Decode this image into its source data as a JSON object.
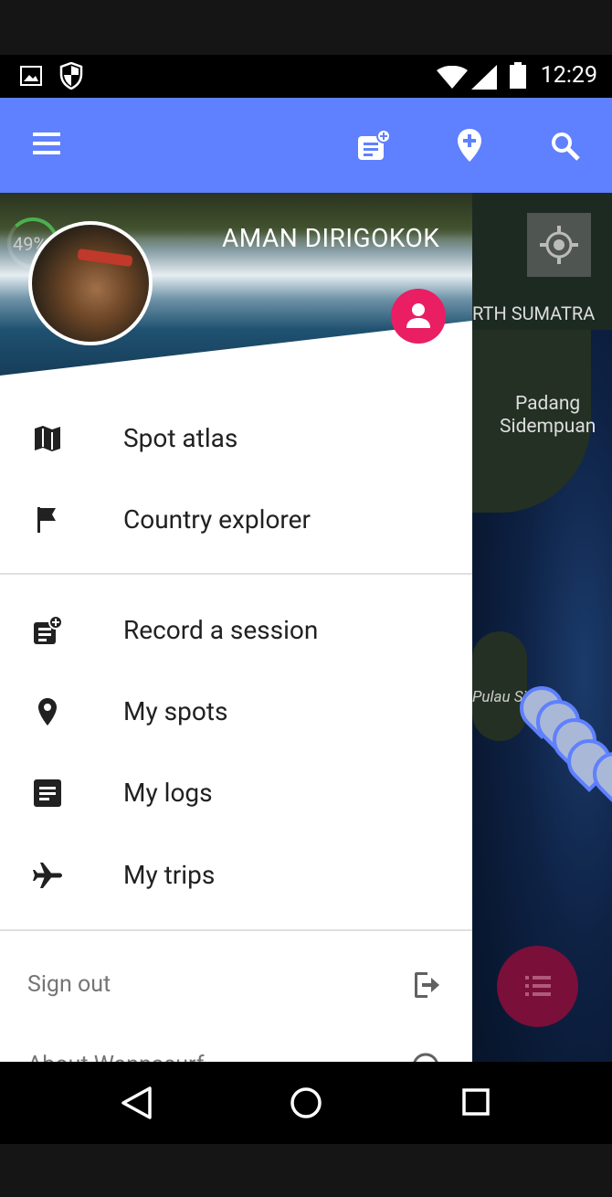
{
  "status_bar": {
    "time": "12:29"
  },
  "profile": {
    "name": "AMAN DIRIGOKOK",
    "progress": "49%"
  },
  "menu": {
    "primary": [
      {
        "label": "Spot atlas",
        "icon": "map-icon"
      },
      {
        "label": "Country explorer",
        "icon": "flag-icon"
      }
    ],
    "secondary": [
      {
        "label": "Record a session",
        "icon": "record-session-icon"
      },
      {
        "label": "My spots",
        "icon": "place-icon"
      },
      {
        "label": "My logs",
        "icon": "logs-icon"
      },
      {
        "label": "My trips",
        "icon": "airplane-icon"
      }
    ],
    "footer": [
      {
        "label": "Sign out",
        "icon": "sign-out-icon"
      },
      {
        "label": "About Wannasurf",
        "icon": "info-icon"
      }
    ]
  },
  "map": {
    "labels": [
      "RTH SUMATRA",
      "Padang",
      "Sidempuan",
      "Pulau Si"
    ]
  },
  "colors": {
    "app_bar": "#5f80ff",
    "accent": "#e91e63",
    "map_water": "#0e2245"
  }
}
